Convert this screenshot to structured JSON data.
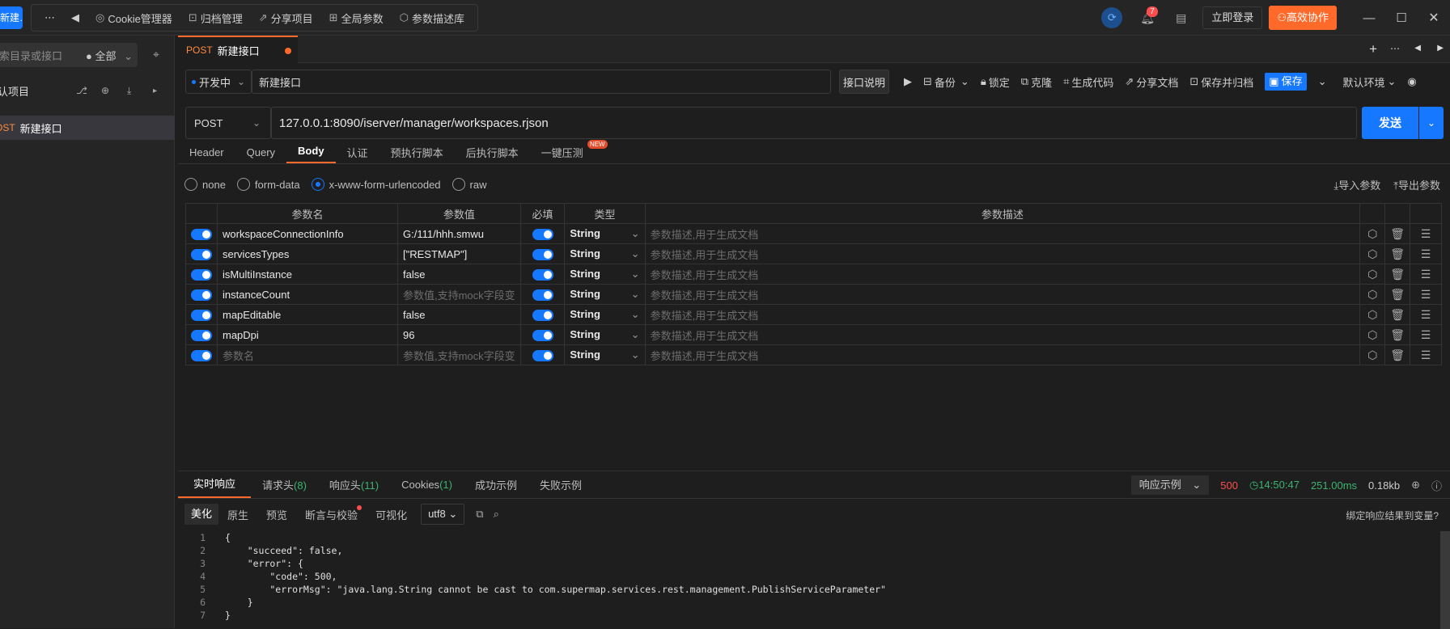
{
  "topbar": {
    "new_btn": "新建…",
    "more": "⋯",
    "back": "◀",
    "nav": [
      {
        "icon": "cookie-icon",
        "label": "Cookie管理器"
      },
      {
        "icon": "archive-icon",
        "label": "归档管理"
      },
      {
        "icon": "share-icon",
        "label": "分享项目"
      },
      {
        "icon": "global-params-icon",
        "label": "全局参数"
      },
      {
        "icon": "cube-icon",
        "label": "参数描述库"
      }
    ],
    "notifications": "7",
    "login": "立即登录",
    "collab": "高效协作"
  },
  "sidebar": {
    "search_placeholder": "搜索目录或接口",
    "filter": "全部",
    "project": "默认项目",
    "item_method": "POST",
    "item_name": "新建接口"
  },
  "tab": {
    "method": "POST",
    "name": "新建接口"
  },
  "toolbar": {
    "status": "开发中",
    "name": "新建接口",
    "doc": "接口说明",
    "backup": "备份",
    "lock": "锁定",
    "clone": "克隆",
    "gencode": "生成代码",
    "sharedoc": "分享文档",
    "savearchive": "保存并归档",
    "save": "保存",
    "env": "默认环境"
  },
  "request": {
    "method": "POST",
    "url": "127.0.0.1:8090/iserver/manager/workspaces.rjson",
    "send": "发送"
  },
  "reqtabs": [
    "Header",
    "Query",
    "Body",
    "认证",
    "预执行脚本",
    "后执行脚本",
    "一键压测"
  ],
  "new_tag": "NEW",
  "body_types": [
    "none",
    "form-data",
    "x-www-form-urlencoded",
    "raw"
  ],
  "import_params": "导入参数",
  "export_params": "导出参数",
  "table": {
    "headers": [
      "参数名",
      "参数值",
      "必填",
      "类型",
      "参数描述"
    ],
    "desc_placeholder": "参数描述,用于生成文档",
    "rows": [
      {
        "name": "workspaceConnectionInfo",
        "value": "G:/111/hhh.smwu",
        "type": "String"
      },
      {
        "name": "servicesTypes",
        "value": "[\"RESTMAP\"]",
        "type": "String"
      },
      {
        "name": "isMultiInstance",
        "value": "false",
        "type": "String"
      },
      {
        "name": "instanceCount",
        "value": "",
        "type": "String"
      },
      {
        "name": "mapEditable",
        "value": "false",
        "type": "String"
      },
      {
        "name": "mapDpi",
        "value": "96",
        "type": "String"
      },
      {
        "name": "",
        "value": "",
        "type": "String"
      }
    ],
    "name_placeholder": "参数名",
    "value_placeholder": "参数值,支持mock字段变"
  },
  "response": {
    "tabs": [
      "实时响应",
      "请求头",
      "响应头",
      "Cookies",
      "成功示例",
      "失败示例"
    ],
    "req_header_count": "(8)",
    "resp_header_count": "(11)",
    "cookie_count": "(1)",
    "example": "响应示例",
    "status": "500",
    "time": "14:50:47",
    "duration": "251.00ms",
    "size": "0.18kb",
    "views": [
      "美化",
      "原生",
      "预览",
      "断言与校验",
      "可视化"
    ],
    "encoding": "utf8",
    "bind": "绑定响应结果到变量?",
    "code": [
      "{",
      "    \"succeed\": false,",
      "    \"error\": {",
      "        \"code\": 500,",
      "        \"errorMsg\": \"java.lang.String cannot be cast to com.supermap.services.rest.management.PublishServiceParameter\"",
      "    }",
      "}"
    ]
  }
}
